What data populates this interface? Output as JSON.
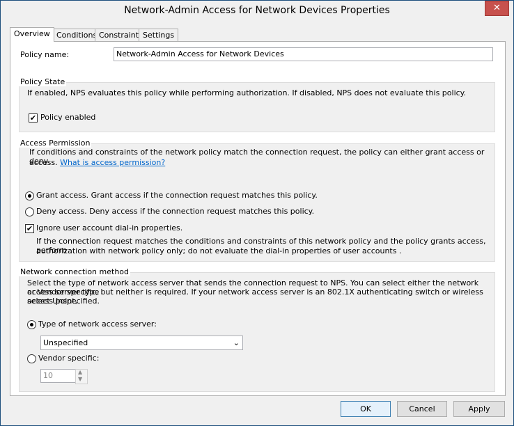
{
  "window": {
    "title": "Network-Admin Access for Network Devices Properties",
    "close_glyph": "✕"
  },
  "tabs": [
    {
      "label": "Overview",
      "active": true
    },
    {
      "label": "Conditions",
      "active": false
    },
    {
      "label": "Constraints",
      "active": false
    },
    {
      "label": "Settings",
      "active": false
    }
  ],
  "overview": {
    "policy_name_label": "Policy name:",
    "policy_name_value": "Network-Admin Access for Network Devices",
    "policy_state": {
      "title": "Policy State",
      "description": "If enabled, NPS evaluates this policy while performing authorization. If disabled, NPS does not evaluate this policy.",
      "enabled_label": "Policy enabled",
      "enabled": true
    },
    "access_permission": {
      "title": "Access Permission",
      "description_line1": "If conditions and constraints of the network policy match the connection request, the policy can either grant access or deny",
      "description_line2": "access.",
      "link": "What is access permission?",
      "grant_label": "Grant access. Grant access if the connection request matches this policy.",
      "deny_label": "Deny access. Deny access if the connection request matches this policy.",
      "selected": "grant",
      "ignore_label": "Ignore user account dial-in properties.",
      "ignore_checked": true,
      "ignore_desc_line1": "If the connection request matches the conditions and constraints of this network policy and the policy grants access, perform",
      "ignore_desc_line2": "authorization with network policy only; do not evaluate the dial-in properties of user accounts ."
    },
    "network_method": {
      "title": "Network connection method",
      "desc_line1": "Select the type of network access server that sends the connection request to NPS. You can select either the network access server type",
      "desc_line2": "or Vendor specific, but neither is required.  If your network access server is an 802.1X authenticating switch or wireless access point,",
      "desc_line3": "select Unspecified.",
      "type_label": "Type of network access server:",
      "type_value": "Unspecified",
      "vendor_label": "Vendor specific:",
      "vendor_value": "10",
      "selected": "type"
    }
  },
  "buttons": {
    "ok": "OK",
    "cancel": "Cancel",
    "apply": "Apply"
  }
}
